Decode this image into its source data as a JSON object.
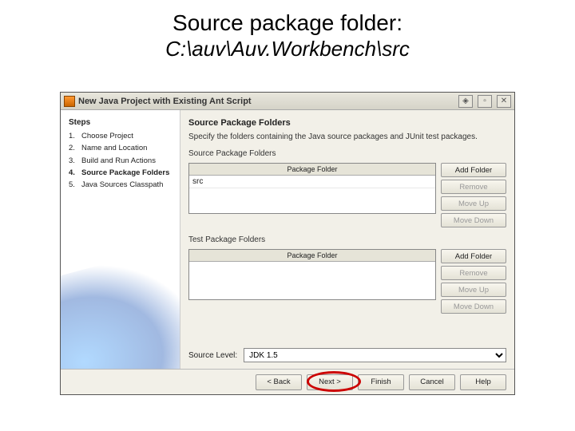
{
  "slide": {
    "title": "Source package folder:",
    "subtitle": "C:\\auv\\Auv.Workbench\\src"
  },
  "dialog": {
    "title": "New Java Project with Existing Ant Script",
    "steps_header": "Steps",
    "steps": [
      {
        "num": "1.",
        "label": "Choose Project"
      },
      {
        "num": "2.",
        "label": "Name and Location"
      },
      {
        "num": "3.",
        "label": "Build and Run Actions"
      },
      {
        "num": "4.",
        "label": "Source Package Folders"
      },
      {
        "num": "5.",
        "label": "Java Sources Classpath"
      }
    ],
    "active_step_index": 3,
    "main": {
      "heading": "Source Package Folders",
      "desc": "Specify the folders containing the Java source packages and JUnit test packages.",
      "src_label": "Source Package Folders",
      "col_header": "Package Folder",
      "src_row": "src",
      "test_label": "Test Package Folders",
      "btns": {
        "add": "Add Folder",
        "remove": "Remove",
        "up": "Move Up",
        "down": "Move Down"
      },
      "source_level_label": "Source Level:",
      "source_level_value": "JDK 1.5"
    },
    "footer": {
      "back": "< Back",
      "next": "Next >",
      "finish": "Finish",
      "cancel": "Cancel",
      "help": "Help"
    }
  }
}
